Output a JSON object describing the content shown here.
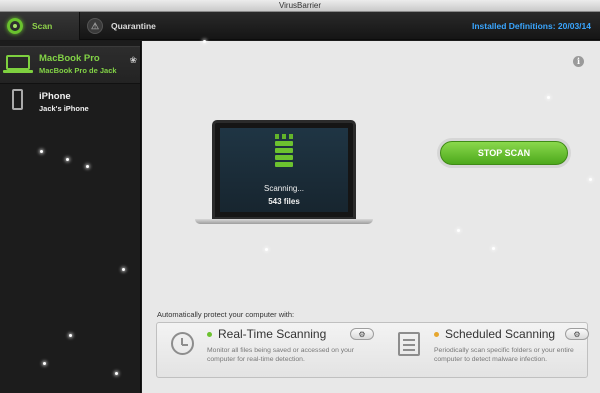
{
  "window": {
    "title": "VirusBarrier"
  },
  "toolbar": {
    "tabs": [
      {
        "label": "Scan",
        "icon": "scan-ring-icon"
      },
      {
        "label": "Quarantine",
        "icon": "quarantine-icon"
      }
    ],
    "definitions": "Installed Definitions: 20/03/14"
  },
  "sidebar": {
    "devices": [
      {
        "name": "MacBook Pro",
        "subtitle": "MacBook Pro de Jack",
        "icon": "laptop-icon",
        "selected": true
      },
      {
        "name": "iPhone",
        "subtitle": "Jack's iPhone",
        "icon": "iphone-icon",
        "selected": false
      }
    ]
  },
  "scan": {
    "status": "Scanning...",
    "count": "543 files",
    "stop_label": "STOP SCAN"
  },
  "auto_protect": {
    "heading": "Automatically protect your computer with:",
    "realtime": {
      "title": "Real-Time Scanning",
      "description": "Monitor all files being saved or accessed on your computer for real-time detection.",
      "status_color": "#6cc22f"
    },
    "scheduled": {
      "title": "Scheduled Scanning",
      "description": "Periodically scan specific folders or your entire computer to detect malware infection.",
      "status_color": "#e6a62e"
    }
  },
  "colors": {
    "accent_green": "#6cc22f",
    "definitions_blue": "#3aa6ff"
  }
}
